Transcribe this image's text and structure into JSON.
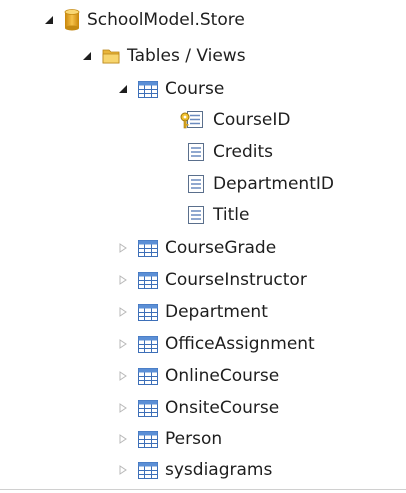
{
  "tree": {
    "root": {
      "label": "SchoolModel.Store",
      "icon": "database-icon",
      "expanded": true
    },
    "folder": {
      "label": "Tables / Views",
      "icon": "folder-icon",
      "expanded": true
    },
    "course": {
      "label": "Course",
      "icon": "table-icon",
      "expanded": true,
      "columns": [
        {
          "label": "CourseID",
          "icon": "key-column-icon",
          "primary_key": true
        },
        {
          "label": "Credits",
          "icon": "column-icon",
          "primary_key": false
        },
        {
          "label": "DepartmentID",
          "icon": "column-icon",
          "primary_key": false
        },
        {
          "label": "Title",
          "icon": "column-icon",
          "primary_key": false
        }
      ]
    },
    "tables": [
      {
        "label": "CourseGrade",
        "icon": "table-icon",
        "expanded": false
      },
      {
        "label": "CourseInstructor",
        "icon": "table-icon",
        "expanded": false
      },
      {
        "label": "Department",
        "icon": "table-icon",
        "expanded": false
      },
      {
        "label": "OfficeAssignment",
        "icon": "table-icon",
        "expanded": false
      },
      {
        "label": "OnlineCourse",
        "icon": "table-icon",
        "expanded": false
      },
      {
        "label": "OnsiteCourse",
        "icon": "table-icon",
        "expanded": false
      },
      {
        "label": "Person",
        "icon": "table-icon",
        "expanded": false
      },
      {
        "label": "sysdiagrams",
        "icon": "table-icon",
        "expanded": false
      }
    ]
  },
  "colors": {
    "text": "#1e1e1e",
    "expanded_arrow": "#1e1e1e",
    "collapsed_arrow": "#b8b8b8",
    "db_gold": "#e7a81a",
    "folder_yellow": "#f2c94c",
    "table_blue": "#5b8fd6"
  }
}
